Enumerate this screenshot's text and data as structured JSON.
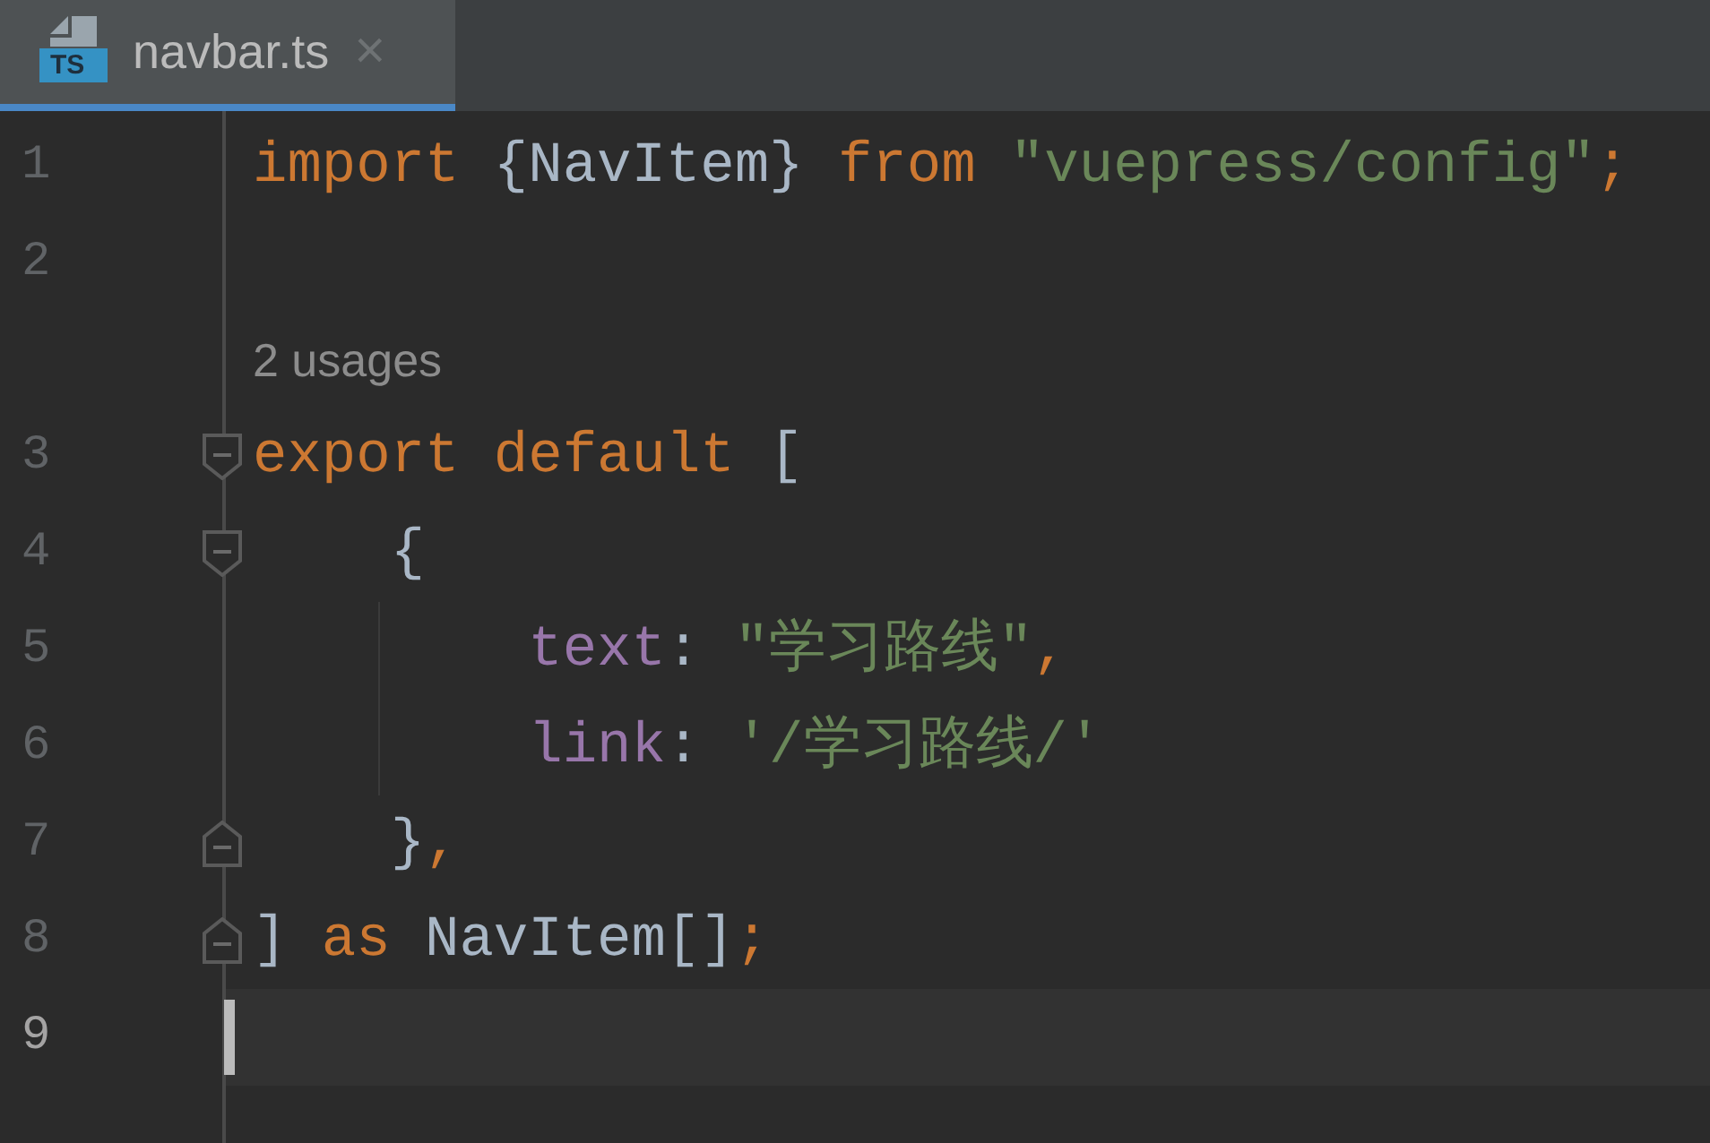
{
  "tabs": [
    {
      "label": "navbar.ts",
      "selected": true,
      "badge": "TS",
      "close": "×"
    }
  ],
  "lines": [
    {
      "number": "1",
      "kind": "plain",
      "current": false,
      "tokens": [
        {
          "kind": "keyword",
          "text": "import "
        },
        {
          "kind": "plain",
          "text": "{NavItem} "
        },
        {
          "kind": "keyword",
          "text": "from "
        },
        {
          "kind": "string",
          "text": "\"vuepress/config\""
        },
        {
          "kind": "keyword",
          "text": ";"
        }
      ]
    },
    {
      "number": "2",
      "kind": "plain",
      "current": false
    },
    {
      "kind": "hint",
      "hint": "2 usages"
    },
    {
      "number": "3",
      "kind": "open",
      "current": false,
      "tokens": [
        {
          "kind": "keyword",
          "text": "export default "
        },
        {
          "kind": "plain",
          "text": "["
        }
      ]
    },
    {
      "number": "4",
      "kind": "open",
      "current": false,
      "tokens": [
        {
          "kind": "plain",
          "text": "    {"
        }
      ]
    },
    {
      "number": "5",
      "kind": "plain",
      "current": false,
      "guide": true,
      "tokens": [
        {
          "kind": "property",
          "text": "        text"
        },
        {
          "kind": "plain",
          "text": ": "
        },
        {
          "kind": "string",
          "text": "\"学习路线\""
        },
        {
          "kind": "keyword",
          "text": ","
        }
      ]
    },
    {
      "number": "6",
      "kind": "plain",
      "current": false,
      "guide": true,
      "tokens": [
        {
          "kind": "property",
          "text": "        link"
        },
        {
          "kind": "plain",
          "text": ": "
        },
        {
          "kind": "string",
          "text": "'/学习路线/'"
        }
      ]
    },
    {
      "number": "7",
      "kind": "close",
      "current": false,
      "tokens": [
        {
          "kind": "plain",
          "text": "    }"
        },
        {
          "kind": "keyword",
          "text": ","
        }
      ]
    },
    {
      "number": "8",
      "kind": "close",
      "current": false,
      "tokens": [
        {
          "kind": "plain",
          "text": "] "
        },
        {
          "kind": "keyword",
          "text": "as "
        },
        {
          "kind": "plain",
          "text": "NavItem[]"
        },
        {
          "kind": "keyword",
          "text": ";"
        }
      ]
    },
    {
      "number": "9",
      "kind": "plain",
      "current": true
    }
  ]
}
